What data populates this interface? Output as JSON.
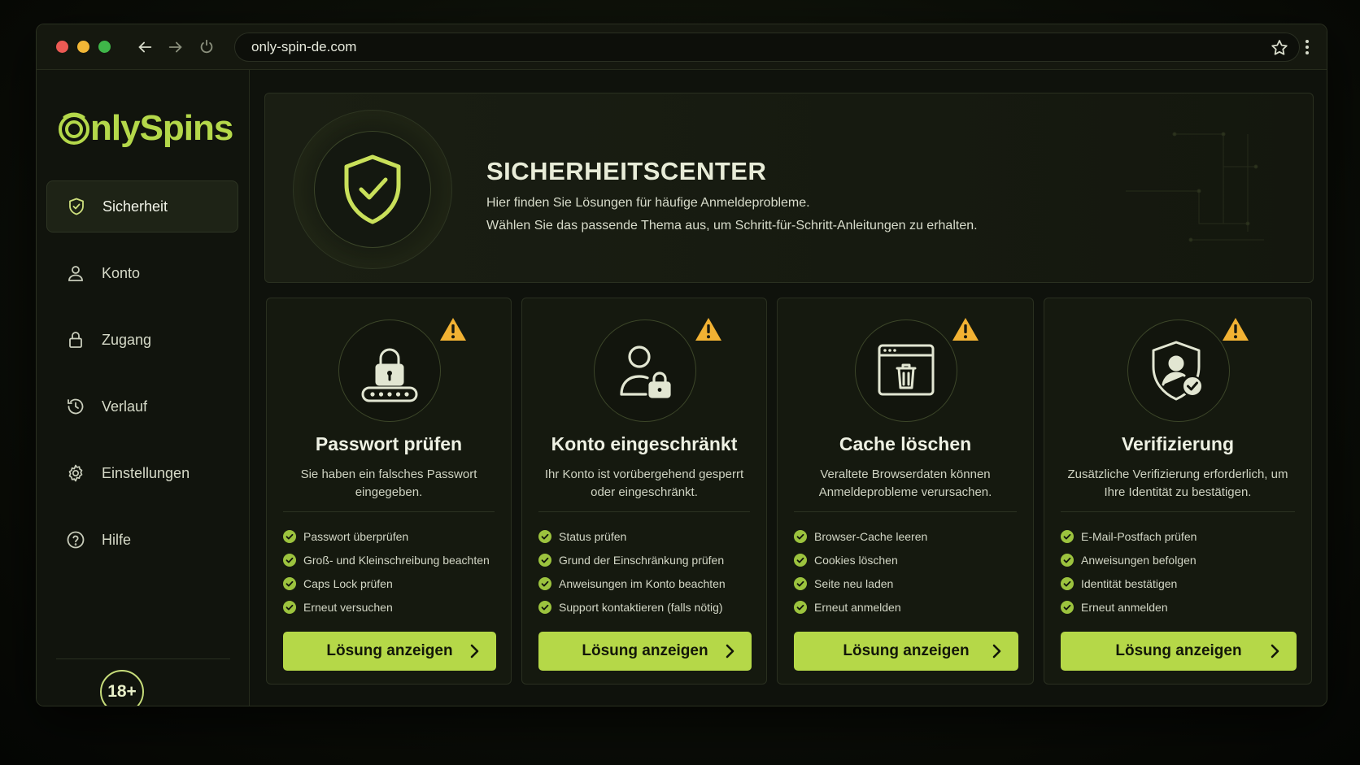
{
  "browser": {
    "url": "only-spin-de.com"
  },
  "sidebar": {
    "logo_text": "nlySpins",
    "items": [
      {
        "label": "Sicherheit",
        "icon": "shield-check-icon",
        "active": true
      },
      {
        "label": "Konto",
        "icon": "user-icon",
        "active": false
      },
      {
        "label": "Zugang",
        "icon": "lock-icon",
        "active": false
      },
      {
        "label": "Verlauf",
        "icon": "history-icon",
        "active": false
      },
      {
        "label": "Einstellungen",
        "icon": "gear-icon",
        "active": false
      },
      {
        "label": "Hilfe",
        "icon": "help-icon",
        "active": false
      }
    ],
    "age_badge": "18+"
  },
  "hero": {
    "title": "SICHERHEITSCENTER",
    "line1": "Hier finden Sie Lösungen für häufige Anmeldeprobleme.",
    "line2": "Wählen Sie das passende Thema aus, um Schritt-für-Schritt-Anleitungen zu erhalten."
  },
  "cards": [
    {
      "title": "Passwort prüfen",
      "desc": "Sie haben ein falsches Passwort eingegeben.",
      "icon": "password-lock-icon",
      "checks": [
        "Passwort überprüfen",
        "Groß- und Kleinschreibung beachten",
        "Caps Lock prüfen",
        "Erneut versuchen"
      ],
      "button": "Lösung anzeigen"
    },
    {
      "title": "Konto eingeschränkt",
      "desc": "Ihr Konto ist vorübergehend gesperrt oder eingeschränkt.",
      "icon": "user-lock-icon",
      "checks": [
        "Status prüfen",
        "Grund der Einschränkung prüfen",
        "Anweisungen im Konto beachten",
        "Support kontaktieren (falls nötig)"
      ],
      "button": "Lösung anzeigen"
    },
    {
      "title": "Cache löschen",
      "desc": "Veraltete Browserdaten können Anmeldeprobleme verursachen.",
      "icon": "browser-trash-icon",
      "checks": [
        "Browser-Cache leeren",
        "Cookies löschen",
        "Seite neu laden",
        "Erneut anmelden"
      ],
      "button": "Lösung anzeigen"
    },
    {
      "title": "Verifizierung",
      "desc": "Zusätzliche Verifizierung erforderlich, um Ihre Identität zu bestätigen.",
      "icon": "shield-user-check-icon",
      "checks": [
        "E-Mail-Postfach prüfen",
        "Anweisungen befolgen",
        "Identität bestätigen",
        "Erneut anmelden"
      ],
      "button": "Lösung anzeigen"
    }
  ],
  "colors": {
    "accent": "#b5d848",
    "warning": "#f2b233",
    "background": "#0f120c"
  }
}
